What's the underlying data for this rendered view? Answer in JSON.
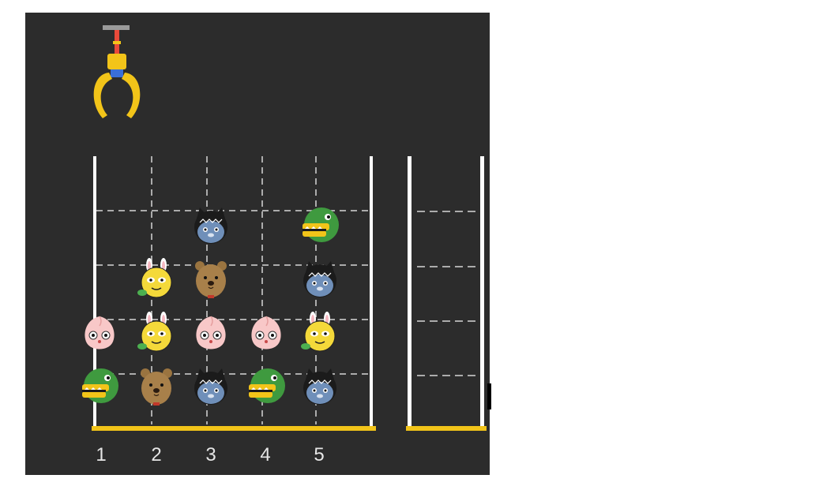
{
  "game": {
    "columns": [
      "1",
      "2",
      "3",
      "4",
      "5"
    ],
    "grid_rows_top_to_bottom": [
      [
        "empty",
        "empty",
        "empty",
        "empty",
        "empty"
      ],
      [
        "empty",
        "empty",
        "cat",
        "empty",
        "crocodile"
      ],
      [
        "empty",
        "rabbit",
        "bear",
        "empty",
        "cat"
      ],
      [
        "peach",
        "rabbit",
        "peach",
        "peach",
        "rabbit"
      ],
      [
        "crocodile",
        "bear",
        "cat",
        "crocodile",
        "cat"
      ]
    ],
    "basket_rows": 4,
    "colors": {
      "background": "#2c2c2c",
      "wall": "#ffffff",
      "floor": "#f2c419",
      "claw": "#f2c419",
      "claw_joint": "#3a6fd8",
      "claw_arm": "#e94a3a"
    }
  }
}
